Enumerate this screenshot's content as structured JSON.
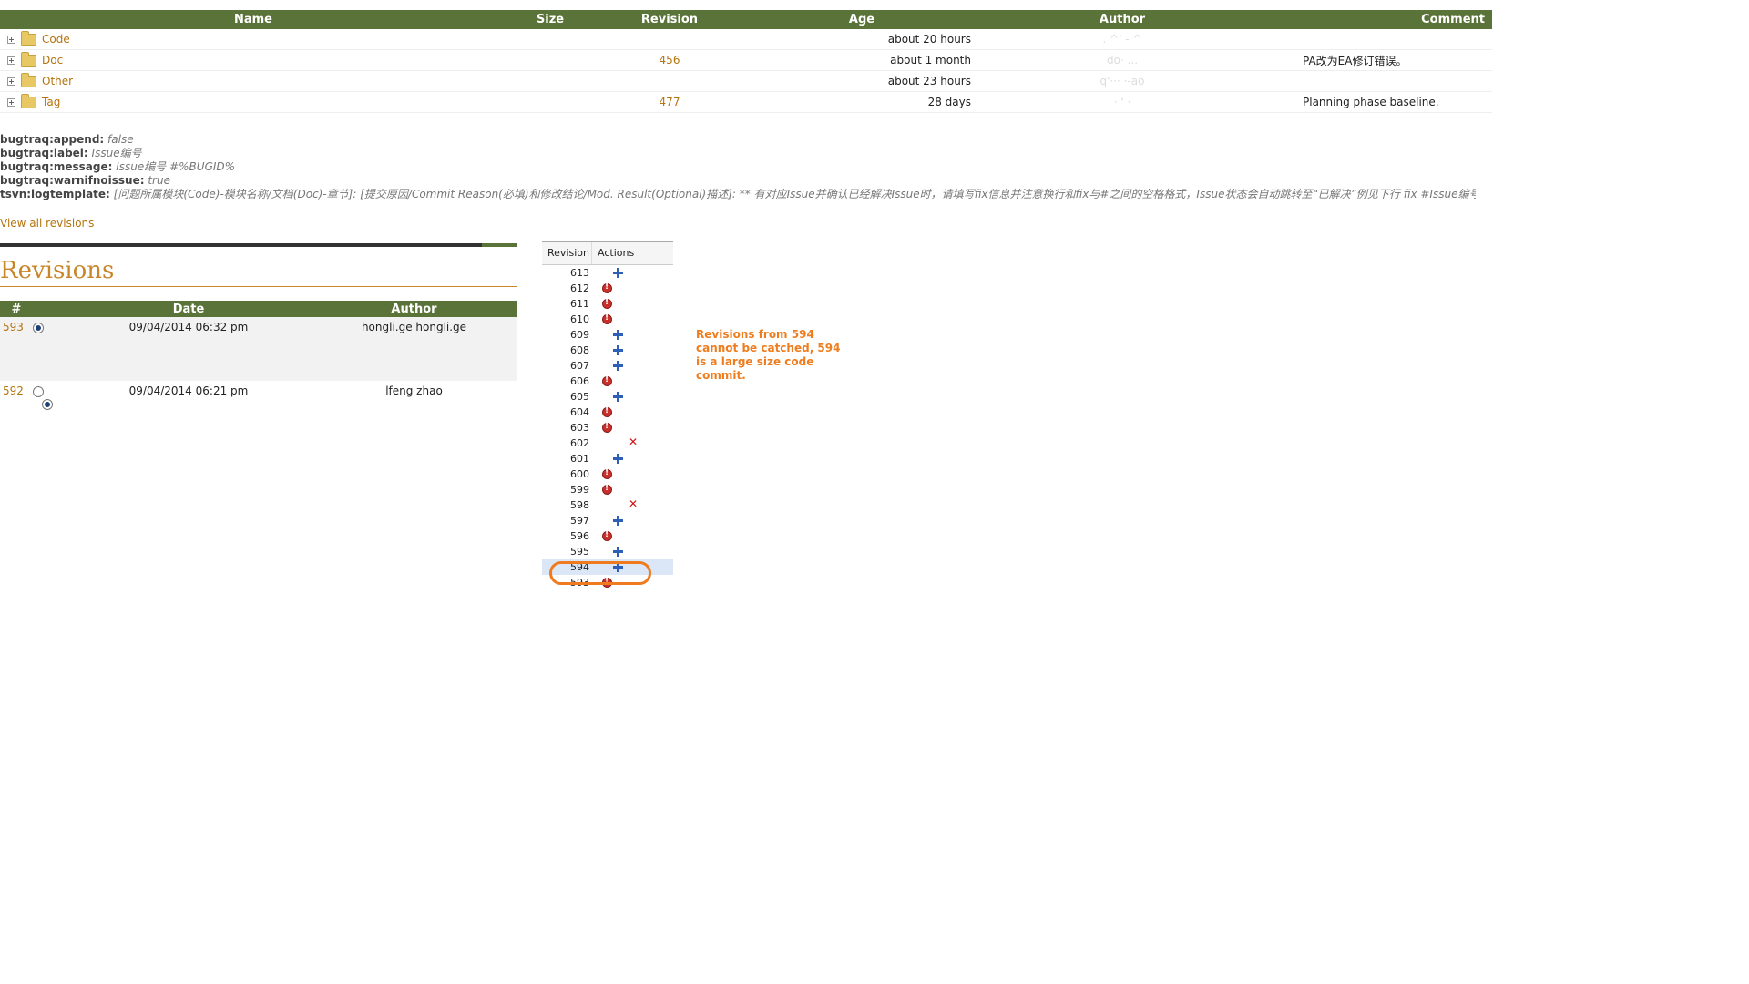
{
  "files": {
    "headers": [
      "Name",
      "Size",
      "Revision",
      "Age",
      "Author",
      "Comment"
    ],
    "rows": [
      {
        "name": "Code",
        "size": "",
        "revision": "",
        "age": "about 20 hours",
        "author": ". ^' - ^",
        "comment": ""
      },
      {
        "name": "Doc",
        "size": "",
        "revision": "456",
        "age": "about 1 month",
        "author": "do· ...",
        "comment": "PA改为EA修订错误。"
      },
      {
        "name": "Other",
        "size": "",
        "revision": "",
        "age": "about 23 hours",
        "author": "q'··· ·-ao",
        "comment": ""
      },
      {
        "name": "Tag",
        "size": "",
        "revision": "477",
        "age": "28 days",
        "author": "· ' ·",
        "comment": "Planning phase baseline."
      }
    ]
  },
  "props": [
    {
      "key": "bugtraq:append:",
      "value": "false"
    },
    {
      "key": "bugtraq:label:",
      "value": "Issue编号"
    },
    {
      "key": "bugtraq:message:",
      "value": "Issue编号 #%BUGID%"
    },
    {
      "key": "bugtraq:warnifnoissue:",
      "value": "true"
    },
    {
      "key": "tsvn:logtemplate:",
      "value": "[问题所属模块(Code)-模块名称/文档(Doc)-章节]: [提交原因/Commit Reason(必填)和修改结论/Mod. Result(Optional)描述]: ** 有对应Issue并确认已经解决Issue时，请填写fix信息并注意换行和fix与#之间的空格格式，Issue状态会自动跳转至“已解决”例见下行 fix #Issue编号 **"
    }
  ],
  "view_all": "View all revisions",
  "revisions": {
    "title": "Revisions",
    "headers": [
      "#",
      "Date",
      "Author"
    ],
    "rows": [
      {
        "num": "593",
        "date": "09/04/2014 06:32 pm",
        "author": "hongli.ge hongli.ge"
      },
      {
        "num": "592",
        "date": "09/04/2014 06:21 pm",
        "author": "lfeng zhao"
      }
    ]
  },
  "revlist": {
    "headers": [
      "Revision",
      "Actions"
    ],
    "rows": [
      {
        "rev": "613",
        "action": "add"
      },
      {
        "rev": "612",
        "action": "modify"
      },
      {
        "rev": "611",
        "action": "modify"
      },
      {
        "rev": "610",
        "action": "modify"
      },
      {
        "rev": "609",
        "action": "add"
      },
      {
        "rev": "608",
        "action": "add"
      },
      {
        "rev": "607",
        "action": "add"
      },
      {
        "rev": "606",
        "action": "modify"
      },
      {
        "rev": "605",
        "action": "add"
      },
      {
        "rev": "604",
        "action": "modify"
      },
      {
        "rev": "603",
        "action": "modify"
      },
      {
        "rev": "602",
        "action": "delete"
      },
      {
        "rev": "601",
        "action": "add"
      },
      {
        "rev": "600",
        "action": "modify"
      },
      {
        "rev": "599",
        "action": "modify"
      },
      {
        "rev": "598",
        "action": "delete"
      },
      {
        "rev": "597",
        "action": "add"
      },
      {
        "rev": "596",
        "action": "modify"
      },
      {
        "rev": "595",
        "action": "add"
      },
      {
        "rev": "594",
        "action": "add",
        "highlight": true
      },
      {
        "rev": "593",
        "action": "modify"
      }
    ]
  },
  "note": "Revisions from 594 cannot be catched, 594 is a large size code commit.",
  "colors": {
    "header_green": "#5a7339",
    "link": "#b5740f",
    "note": "#ef7d1e"
  }
}
